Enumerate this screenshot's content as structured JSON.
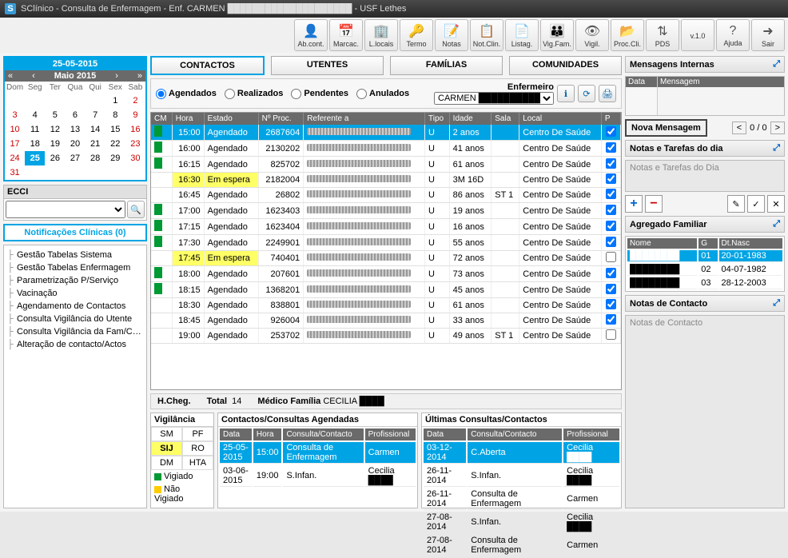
{
  "title": "SClínico - Consulta de Enfermagem -  Enf. CARMEN ████████████████████ - USF Lethes",
  "toolbar": [
    {
      "label": "Ab.cont.",
      "icon": "👤"
    },
    {
      "label": "Marcac.",
      "icon": "📅"
    },
    {
      "label": "L.locais",
      "icon": "🏢"
    },
    {
      "label": "Termo",
      "icon": "🔑"
    },
    {
      "label": "Notas",
      "icon": "📝"
    },
    {
      "label": "Not.Clin.",
      "icon": "📋"
    },
    {
      "label": "Listag.",
      "icon": "📄"
    },
    {
      "label": "Vig.Fam.",
      "icon": "👪"
    },
    {
      "label": "Vigil.",
      "icon": "👁"
    },
    {
      "label": "Proc.Cli.",
      "icon": "📂"
    },
    {
      "label": "PDS",
      "icon": "⇅"
    },
    {
      "label": "v.1.0",
      "icon": ""
    },
    {
      "label": "Ajuda",
      "icon": "?"
    },
    {
      "label": "Sair",
      "icon": "➜"
    }
  ],
  "calendar": {
    "date": "25-05-2015",
    "month": "Maio 2015",
    "weekdays": [
      "Dom",
      "Seg",
      "Ter",
      "Qua",
      "Qui",
      "Sex",
      "Sab"
    ],
    "days": [
      [
        "",
        "",
        "",
        "",
        "",
        "1",
        "2"
      ],
      [
        "3",
        "4",
        "5",
        "6",
        "7",
        "8",
        "9"
      ],
      [
        "10",
        "11",
        "12",
        "13",
        "14",
        "15",
        "16"
      ],
      [
        "17",
        "18",
        "19",
        "20",
        "21",
        "22",
        "23"
      ],
      [
        "24",
        "25",
        "26",
        "27",
        "28",
        "29",
        "30"
      ],
      [
        "31",
        "",
        "",
        "",
        "",
        "",
        ""
      ]
    ],
    "selected": "25"
  },
  "ecci": {
    "label": "ECCI"
  },
  "notif": "Notificações Clínicas  (0)",
  "tree": [
    "Gestão Tabelas Sistema",
    "Gestão Tabelas Enfermagem",
    "Parametrização P/Serviço",
    "Vacinação",
    "Agendamento de Contactos",
    "Consulta Vigilância do Utente",
    "Consulta Vigilância da Fam/Com",
    "Alteração de contacto/Actos"
  ],
  "tabs": [
    "CONTACTOS",
    "UTENTES",
    "FAMÍLIAS",
    "COMUNIDADES"
  ],
  "filters": {
    "options": [
      "Agendados",
      "Realizados",
      "Pendentes",
      "Anulados"
    ],
    "nurse_label": "Enfermeiro",
    "nurse": "CARMEN ██████████..."
  },
  "cols": [
    "CM",
    "Hora",
    "Estado",
    "Nº Proc.",
    "Referente a",
    "Tipo",
    "Idade",
    "Sala",
    "Local",
    "P"
  ],
  "rows": [
    {
      "cm": true,
      "hora": "15:00",
      "estado": "Agendado",
      "proc": "2687604",
      "tipo": "U",
      "idade": "2 anos",
      "sala": "",
      "local": "Centro De Saúde",
      "p": true,
      "sel": true
    },
    {
      "cm": true,
      "hora": "16:00",
      "estado": "Agendado",
      "proc": "2130202",
      "tipo": "U",
      "idade": "41 anos",
      "sala": "",
      "local": "Centro De Saúde",
      "p": true
    },
    {
      "cm": true,
      "hora": "16:15",
      "estado": "Agendado",
      "proc": "825702",
      "tipo": "U",
      "idade": "61 anos",
      "sala": "",
      "local": "Centro De Saúde",
      "p": true
    },
    {
      "cm": false,
      "hora": "16:30",
      "estado": "Em espera",
      "proc": "2182004",
      "tipo": "U",
      "idade": "3M 16D",
      "sala": "",
      "local": "Centro De Saúde",
      "p": true,
      "wait": true
    },
    {
      "cm": false,
      "hora": "16:45",
      "estado": "Agendado",
      "proc": "26802",
      "tipo": "U",
      "idade": "86 anos",
      "sala": "ST 1",
      "local": "Centro De Saúde",
      "p": true
    },
    {
      "cm": true,
      "hora": "17:00",
      "estado": "Agendado",
      "proc": "1623403",
      "tipo": "U",
      "idade": "19 anos",
      "sala": "",
      "local": "Centro De Saúde",
      "p": true
    },
    {
      "cm": true,
      "hora": "17:15",
      "estado": "Agendado",
      "proc": "1623404",
      "tipo": "U",
      "idade": "16 anos",
      "sala": "",
      "local": "Centro De Saúde",
      "p": true
    },
    {
      "cm": true,
      "hora": "17:30",
      "estado": "Agendado",
      "proc": "2249901",
      "tipo": "U",
      "idade": "55 anos",
      "sala": "",
      "local": "Centro De Saúde",
      "p": true
    },
    {
      "cm": false,
      "hora": "17:45",
      "estado": "Em espera",
      "proc": "740401",
      "tipo": "U",
      "idade": "72 anos",
      "sala": "",
      "local": "Centro De Saúde",
      "p": false,
      "wait": true
    },
    {
      "cm": true,
      "hora": "18:00",
      "estado": "Agendado",
      "proc": "207601",
      "tipo": "U",
      "idade": "73 anos",
      "sala": "",
      "local": "Centro De Saúde",
      "p": true
    },
    {
      "cm": true,
      "hora": "18:15",
      "estado": "Agendado",
      "proc": "1368201",
      "tipo": "U",
      "idade": "45 anos",
      "sala": "",
      "local": "Centro De Saúde",
      "p": true
    },
    {
      "cm": false,
      "hora": "18:30",
      "estado": "Agendado",
      "proc": "838801",
      "tipo": "U",
      "idade": "61 anos",
      "sala": "",
      "local": "Centro De Saúde",
      "p": true
    },
    {
      "cm": false,
      "hora": "18:45",
      "estado": "Agendado",
      "proc": "926004",
      "tipo": "U",
      "idade": "33 anos",
      "sala": "",
      "local": "Centro De Saúde",
      "p": true
    },
    {
      "cm": false,
      "hora": "19:00",
      "estado": "Agendado",
      "proc": "253702",
      "tipo": "U",
      "idade": "49 anos",
      "sala": "ST 1",
      "local": "Centro De Saúde",
      "p": false
    }
  ],
  "footer": {
    "hcheg": "H.Cheg.",
    "total": "Total",
    "count": "14",
    "medico": "Médico Família",
    "medico_val": "CECILIA ████"
  },
  "vig": {
    "title": "Vigilância",
    "cells": [
      [
        "SM",
        "PF"
      ],
      [
        "SIJ",
        "RO"
      ],
      [
        "DM",
        "HTA"
      ]
    ],
    "leg1": "Vigiado",
    "leg2": "Não Vigiado"
  },
  "sched": {
    "title": "Contactos/Consultas Agendadas",
    "cols": [
      "Data",
      "Hora",
      "Consulta/Contacto",
      "Profissional"
    ],
    "rows": [
      {
        "d": "25-05-2015",
        "h": "15:00",
        "c": "Consulta de Enfermagem",
        "p": "Carmen",
        "sel": true
      },
      {
        "d": "03-06-2015",
        "h": "19:00",
        "c": "S.Infan.",
        "p": "Cecilia ████"
      }
    ]
  },
  "last": {
    "title": "Últimas Consultas/Contactos",
    "cols": [
      "Data",
      "Consulta/Contacto",
      "Profissional"
    ],
    "rows": [
      {
        "d": "03-12-2014",
        "c": "C.Aberta",
        "p": "Cecilia ████",
        "sel": true
      },
      {
        "d": "26-11-2014",
        "c": "S.Infan.",
        "p": "Cecilia ████"
      },
      {
        "d": "26-11-2014",
        "c": "Consulta de Enfermagem",
        "p": "Carmen"
      },
      {
        "d": "27-08-2014",
        "c": "S.Infan.",
        "p": "Cecilia ████"
      },
      {
        "d": "27-08-2014",
        "c": "Consulta de Enfermagem",
        "p": "Carmen"
      }
    ]
  },
  "msgs": {
    "title": "Mensagens Internas",
    "c1": "Data",
    "c2": "Mensagem",
    "new": "Nova Mensagem",
    "nav": "0 / 0"
  },
  "notes": {
    "title": "Notas e Tarefas do dia",
    "body": "Notas e Tarefas do Dia"
  },
  "agg": {
    "title": "Agregado Familiar",
    "cols": [
      "Nome",
      "G",
      "Dt.Nasc"
    ],
    "rows": [
      {
        "n": "████████",
        "g": "01",
        "d": "20-01-1983",
        "sel": true
      },
      {
        "n": "████████",
        "g": "02",
        "d": "04-07-1982"
      },
      {
        "n": "████████",
        "g": "03",
        "d": "28-12-2003"
      }
    ]
  },
  "ncontact": {
    "title": "Notas de Contacto",
    "body": "Notas de Contacto"
  }
}
